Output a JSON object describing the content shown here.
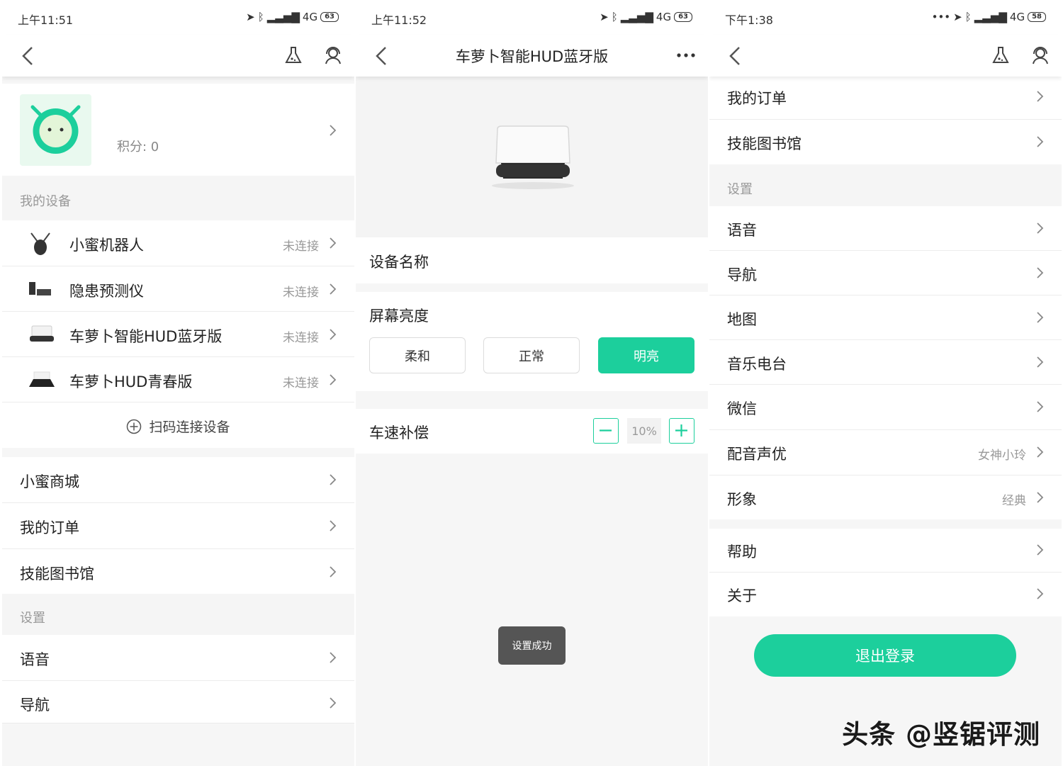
{
  "colors": {
    "accent": "#1ccf9c",
    "toast_bg": "#555555"
  },
  "screen1": {
    "status": {
      "time": "上午11:51",
      "network": "4G",
      "battery": "63"
    },
    "header": {
      "back_icon": "chevron-left-icon",
      "lab_icon": "flask-icon",
      "profile_icon": "user-headset-icon"
    },
    "profile": {
      "points": "积分: 0",
      "avatar_icon": "robot-mascot-icon"
    },
    "devices_header": "我的设备",
    "devices": [
      {
        "name": "小蜜机器人",
        "status": "未连接",
        "icon": "robot-device-icon"
      },
      {
        "name": "隐患预测仪",
        "status": "未连接",
        "icon": "predictor-device-icon"
      },
      {
        "name": "车萝卜智能HUD蓝牙版",
        "status": "未连接",
        "icon": "hud-device-icon"
      },
      {
        "name": "车萝卜HUD青春版",
        "status": "未连接",
        "icon": "hud-lite-device-icon"
      }
    ],
    "scan_connect": "扫码连接设备",
    "menu": [
      "小蜜商城",
      "我的订单",
      "技能图书馆"
    ],
    "settings_header": "设置",
    "settings": [
      "语音",
      "导航"
    ]
  },
  "screen2": {
    "status": {
      "time": "上午11:52",
      "network": "4G",
      "battery": "63"
    },
    "title": "车萝卜智能HUD蓝牙版",
    "more_icon": "more-dots-icon",
    "device_name_label": "设备名称",
    "brightness": {
      "label": "屏幕亮度",
      "options": [
        "柔和",
        "正常",
        "明亮"
      ],
      "selected": "明亮"
    },
    "speed_comp": {
      "label": "车速补偿",
      "value": "10%"
    },
    "toast": "设置成功"
  },
  "screen3": {
    "status": {
      "time": "下午1:38",
      "network": "4G",
      "battery": "58"
    },
    "menu": [
      "我的订单",
      "技能图书馆"
    ],
    "settings_header": "设置",
    "settings": [
      {
        "label": "语音",
        "value": ""
      },
      {
        "label": "导航",
        "value": ""
      },
      {
        "label": "地图",
        "value": ""
      },
      {
        "label": "音乐电台",
        "value": ""
      },
      {
        "label": "微信",
        "value": ""
      },
      {
        "label": "配音声优",
        "value": "女神小玲"
      },
      {
        "label": "形象",
        "value": "经典"
      }
    ],
    "extra": [
      "帮助",
      "关于"
    ],
    "logout": "退出登录"
  },
  "watermark": "头条 @竖锯评测"
}
